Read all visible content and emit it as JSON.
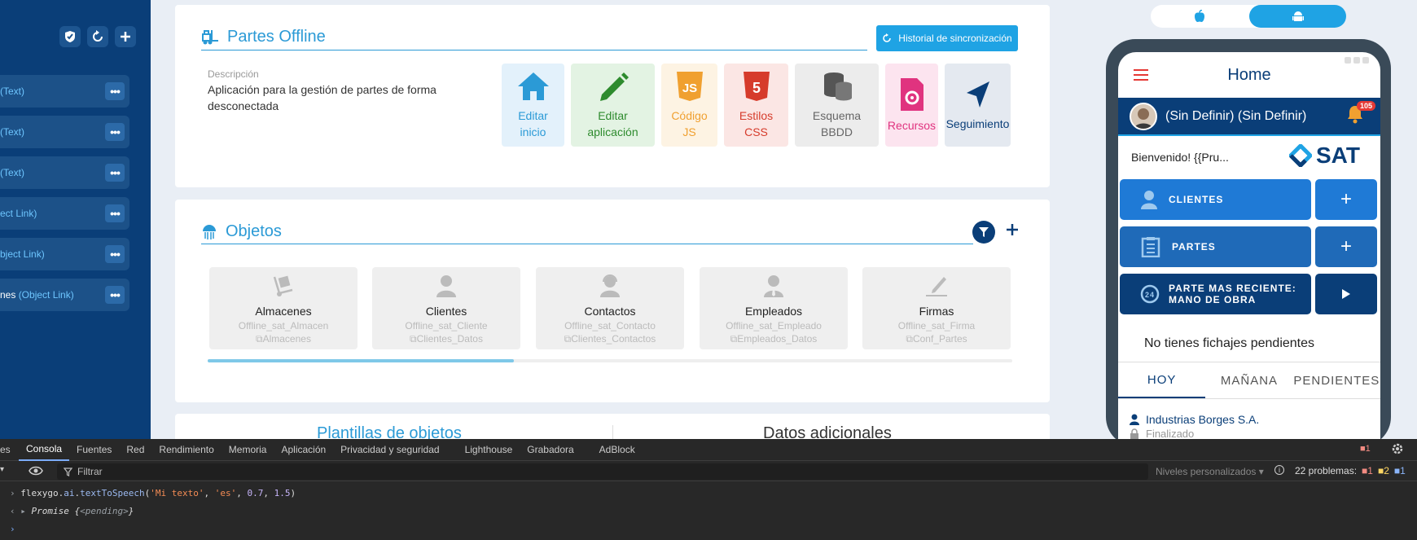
{
  "sidebar": {
    "rows": [
      {
        "name": "",
        "type": "(Text)"
      },
      {
        "name": "",
        "type": "(Text)"
      },
      {
        "name": "",
        "type": "(Text)"
      },
      {
        "name": "",
        "type": "ect Link)"
      },
      {
        "name": "",
        "type": "bject Link)"
      },
      {
        "name": "nes ",
        "type": "(Object Link)"
      }
    ],
    "more_label": "•••"
  },
  "partes": {
    "title": "Partes Offline",
    "history_button": "Historial de sincronización",
    "description_label": "Descripción",
    "description": "Aplicación para la gestión de partes de forma desconectada",
    "tiles": [
      {
        "line1": "Editar",
        "line2": "inicio",
        "color": "#2b9ad6",
        "bg": "#e3f1fb"
      },
      {
        "line1": "Editar",
        "line2": "aplicación",
        "color": "#2e8b2e",
        "bg": "#e3f3e3"
      },
      {
        "line1": "Código",
        "line2": "JS",
        "color": "#f0a030",
        "bg": "#fdf3e3"
      },
      {
        "line1": "Estilos",
        "line2": "CSS",
        "color": "#d63b2b",
        "bg": "#fbe6e4"
      },
      {
        "line1": "Esquema",
        "line2": "BBDD",
        "color": "#666666",
        "bg": "#ececec"
      },
      {
        "line1": "Recursos",
        "line2": "",
        "color": "#e0337f",
        "bg": "#fce4ef"
      },
      {
        "line1": "Seguimiento",
        "line2": "",
        "color": "#0a3e78",
        "bg": "#e4e9f0"
      }
    ]
  },
  "objetos": {
    "title": "Objetos",
    "items": [
      {
        "name": "Almacenes",
        "entity": "Offline_sat_Almacen",
        "table": "Almacenes"
      },
      {
        "name": "Clientes",
        "entity": "Offline_sat_Cliente",
        "table": "Clientes_Datos"
      },
      {
        "name": "Contactos",
        "entity": "Offline_sat_Contacto",
        "table": "Clientes_Contactos"
      },
      {
        "name": "Empleados",
        "entity": "Offline_sat_Empleado",
        "table": "Empleados_Datos"
      },
      {
        "name": "Firmas",
        "entity": "Offline_sat_Firma",
        "table": "Conf_Partes"
      }
    ]
  },
  "bottom_tabs": {
    "left": "Plantillas de objetos",
    "right": "Datos adicionales"
  },
  "phone": {
    "title": "Home",
    "user": "(Sin Definir) (Sin Definir)",
    "badge": "105",
    "welcome": "Bienvenido! {{Pru...",
    "brand": "SAT",
    "buttons": [
      {
        "label": "CLIENTES",
        "color": "#1f7ad6"
      },
      {
        "label": "PARTES",
        "color": "#1f6ab8"
      },
      {
        "label": "PARTE MAS RECIENTE:",
        "label2": "MANO DE OBRA",
        "color": "#0a3e78"
      }
    ],
    "plus": "+",
    "no_fichajes": "No tienes fichajes pendientes",
    "tabs": [
      "HOY",
      "MAÑANA",
      "PENDIENTES"
    ],
    "item_title": "Industrias Borges S.A.",
    "item_status": "Finalizado"
  },
  "devtools": {
    "tabs": [
      "es",
      "Consola",
      "Fuentes",
      "Red",
      "Rendimiento",
      "Memoria",
      "Aplicación",
      "Privacidad y seguridad",
      "Lighthouse",
      "Grabadora",
      "AdBlock"
    ],
    "active_tab": "Consola",
    "filter_placeholder": "Filtrar",
    "levels": "Niveles personalizados ▾",
    "problems_label": "22 problemas:",
    "err_count": "1",
    "err_count2": "1",
    "warn_count": "2",
    "info_count": "1",
    "console_input": "flexygo.ai.textToSpeech('Mi texto', 'es', 0.7, 1.5)",
    "console_output": "Promise {<pending>}"
  }
}
